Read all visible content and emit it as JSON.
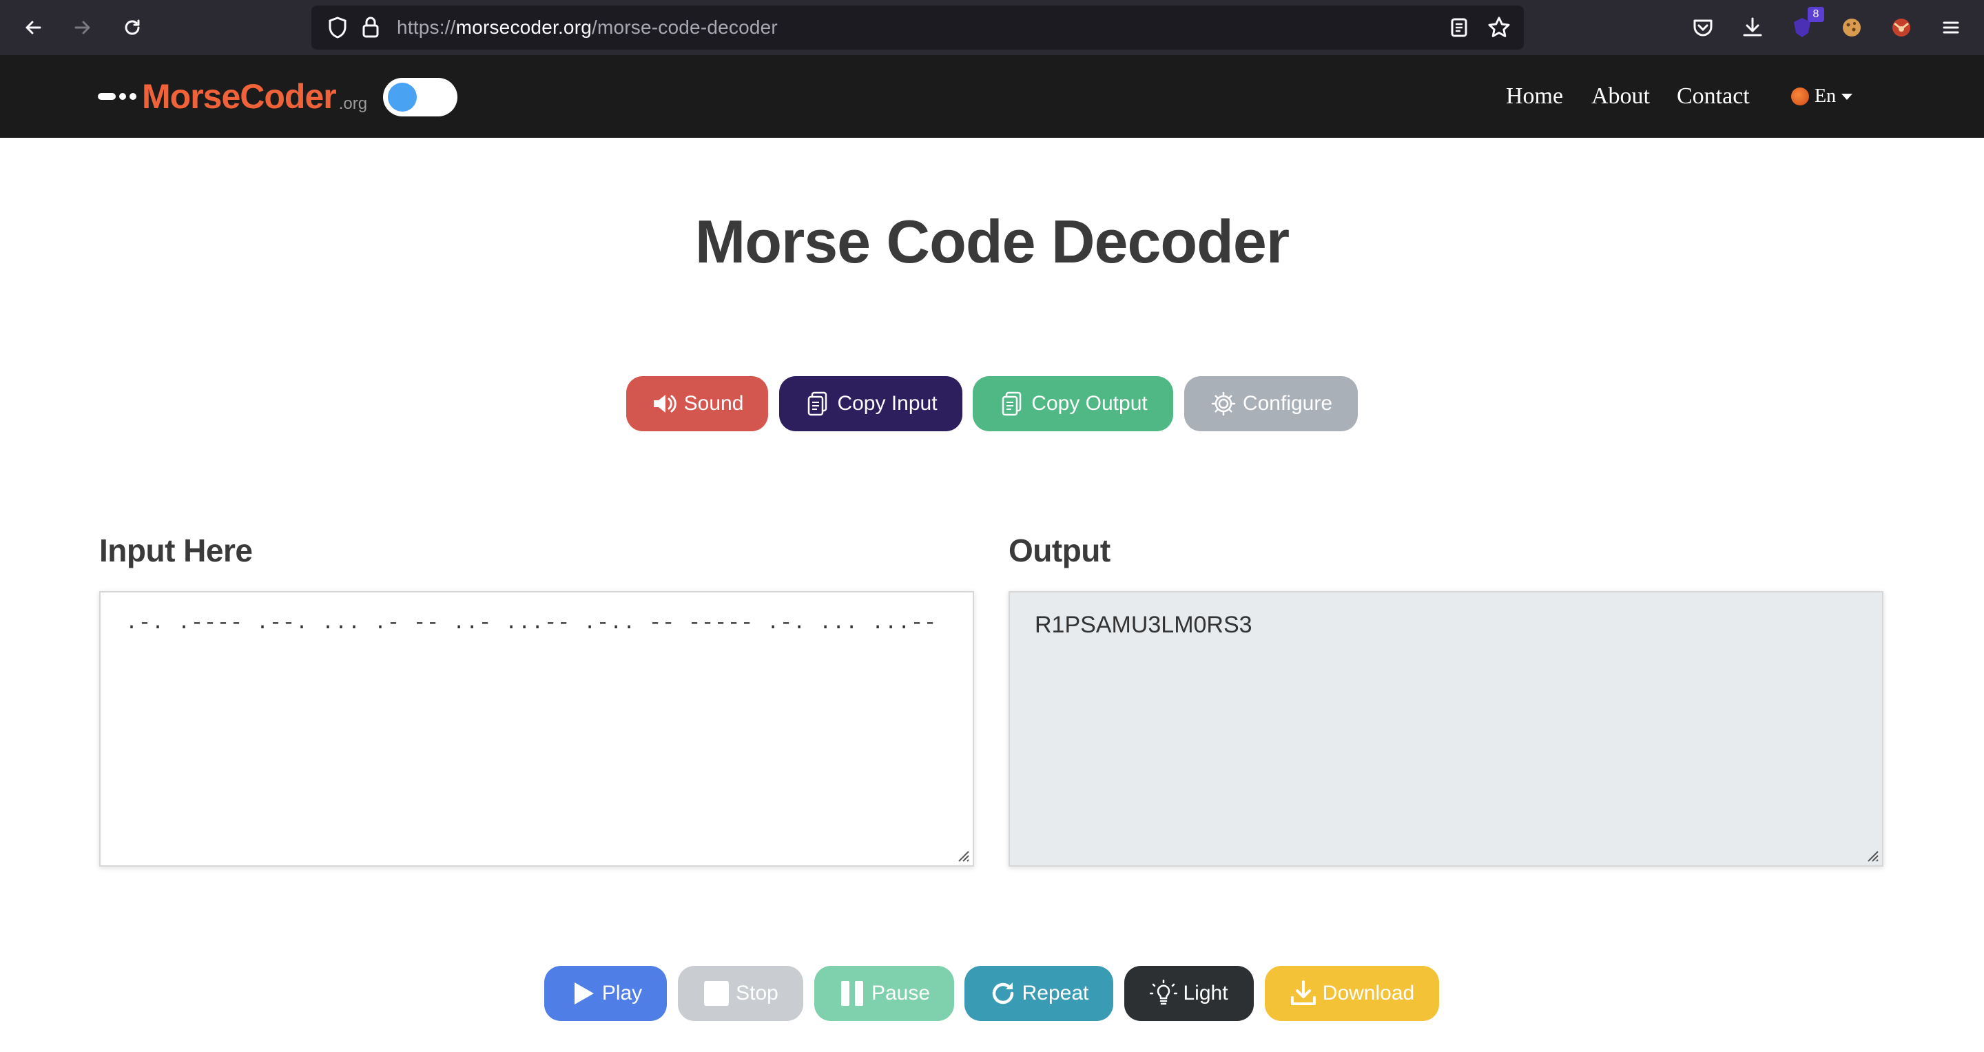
{
  "browser": {
    "url_prefix": "https://",
    "url_host": "morsecoder.org",
    "url_path": "/morse-code-decoder",
    "extension_badge": "8"
  },
  "site": {
    "logo_text": "MorseCoder",
    "logo_suffix": ".org",
    "nav": [
      "Home",
      "About",
      "Contact"
    ],
    "language": "En"
  },
  "page": {
    "title": "Morse Code Decoder"
  },
  "actions": {
    "sound": "Sound",
    "copy_input": "Copy Input",
    "copy_output": "Copy Output",
    "configure": "Configure"
  },
  "input": {
    "label": "Input Here",
    "value": ".-. .---- .--. ... .- -- ..- ...-- .-.. -- ----- .-. ... ...--"
  },
  "output": {
    "label": "Output",
    "value": "R1PSAMU3LM0RS3"
  },
  "controls": {
    "play": "Play",
    "stop": "Stop",
    "pause": "Pause",
    "repeat": "Repeat",
    "light": "Light",
    "download": "Download"
  },
  "colors": {
    "sound": "#d4574f",
    "copy_input": "#2d1f5e",
    "copy_output": "#4fb884",
    "configure": "#aab0b8",
    "play": "#4f7fe6",
    "stop": "#c9ccd0",
    "pause": "#7fd0ac",
    "repeat": "#3a9bb4",
    "light": "#2c3033",
    "download": "#f4c236",
    "brand": "#f0623a"
  }
}
